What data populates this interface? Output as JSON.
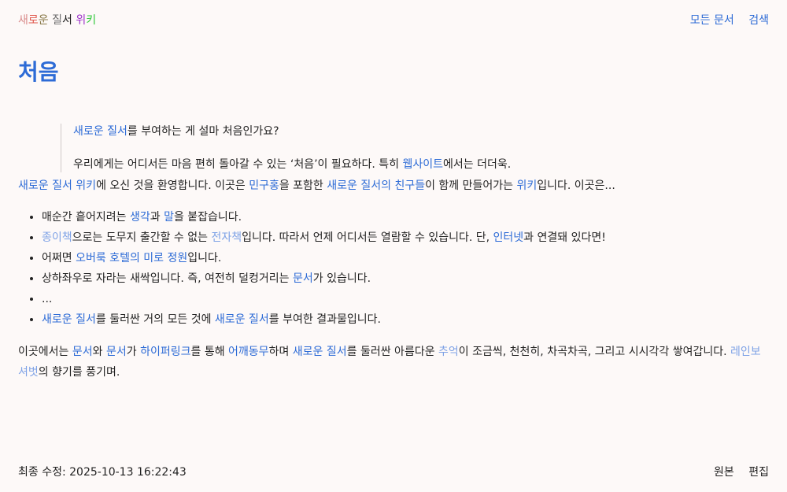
{
  "site_title": {
    "chars": [
      {
        "text": "새",
        "color": "#d98a8a"
      },
      {
        "text": "로",
        "color": "#e0574d"
      },
      {
        "text": "운",
        "color": "#8a7a4a"
      },
      {
        "text": " ",
        "color": "#222222"
      },
      {
        "text": "질",
        "color": "#6b6b6b"
      },
      {
        "text": "서",
        "color": "#222222"
      },
      {
        "text": " ",
        "color": "#222222"
      },
      {
        "text": "위",
        "color": "#9b2fc9"
      },
      {
        "text": "키",
        "color": "#2fc93a"
      }
    ]
  },
  "nav": {
    "all_docs": "모든 문서",
    "search": "검색"
  },
  "page_title": "처음",
  "quote": {
    "line1": [
      {
        "text": "새로운 질서",
        "link": true
      },
      {
        "text": "를 부여하는 게 설마 처음인가요?",
        "link": false
      }
    ],
    "line2": [
      {
        "text": "우리에게는 어디서든 마음 편히 돌아갈 수 있는 ‘처음’이 필요하다. 특히 ",
        "link": false
      },
      {
        "text": "웹사이트",
        "link": true
      },
      {
        "text": "에서는 더더욱.",
        "link": false
      }
    ]
  },
  "intro": [
    {
      "text": "새로운 질서 위키",
      "link": true
    },
    {
      "text": "에 오신 것을 환영합니다. 이곳은 ",
      "link": false
    },
    {
      "text": "민구홍",
      "link": true
    },
    {
      "text": "을 포함한 ",
      "link": false
    },
    {
      "text": "새로운 질서의 친구들",
      "link": true
    },
    {
      "text": "이 함께 만들어가는 ",
      "link": false
    },
    {
      "text": "위키",
      "link": true
    },
    {
      "text": "입니다. 이곳은...",
      "link": false
    }
  ],
  "list_items": [
    [
      {
        "text": "매순간 흩어지려는 ",
        "link": false
      },
      {
        "text": "생각",
        "link": true
      },
      {
        "text": "과 ",
        "link": false
      },
      {
        "text": "말",
        "link": true
      },
      {
        "text": "을 붙잡습니다.",
        "link": false
      }
    ],
    [
      {
        "text": "종이책",
        "link": "light"
      },
      {
        "text": "으로는 도무지 출간할 수 없는 ",
        "link": false
      },
      {
        "text": "전자책",
        "link": "light"
      },
      {
        "text": "입니다. 따라서 언제 어디서든 열람할 수 있습니다. 단, ",
        "link": false
      },
      {
        "text": "인터넷",
        "link": true
      },
      {
        "text": "과 연결돼 있다면!",
        "link": false
      }
    ],
    [
      {
        "text": "어쩌면 ",
        "link": false
      },
      {
        "text": "오버룩 호텔의 미로 정원",
        "link": true
      },
      {
        "text": "입니다.",
        "link": false
      }
    ],
    [
      {
        "text": "상하좌우로 자라는 새싹입니다. 즉, 여전히 덜컹거리는 ",
        "link": false
      },
      {
        "text": "문서",
        "link": true
      },
      {
        "text": "가 있습니다.",
        "link": false
      }
    ],
    [
      {
        "text": "...",
        "link": false
      }
    ],
    [
      {
        "text": "새로운 질서",
        "link": true
      },
      {
        "text": "를 둘러싼 거의 모든 것에 ",
        "link": false
      },
      {
        "text": "새로운 질서",
        "link": true
      },
      {
        "text": "를 부여한 결과물입니다.",
        "link": false
      }
    ]
  ],
  "closing": [
    {
      "text": "이곳에서는 ",
      "link": false
    },
    {
      "text": "문서",
      "link": true
    },
    {
      "text": "와 ",
      "link": false
    },
    {
      "text": "문서",
      "link": true
    },
    {
      "text": "가 ",
      "link": false
    },
    {
      "text": "하이퍼링크",
      "link": true
    },
    {
      "text": "를 통해 ",
      "link": false
    },
    {
      "text": "어깨동무",
      "link": true
    },
    {
      "text": "하며 ",
      "link": false
    },
    {
      "text": "새로운 질서",
      "link": true
    },
    {
      "text": "를 둘러싼 아름다운 ",
      "link": false
    },
    {
      "text": "추억",
      "link": "light"
    },
    {
      "text": "이 조금씩, 천천히, 차곡차곡, 그리고 시시각각 쌓여갑니다. ",
      "link": false
    },
    {
      "text": "레인보 셔벗",
      "link": "light"
    },
    {
      "text": "의 향기를 풍기며.",
      "link": false
    }
  ],
  "footer": {
    "last_modified": "최종 수정: 2025-10-13 16:22:43",
    "source": "원본",
    "edit": "편집"
  },
  "colors": {
    "link": "#2d6bd6",
    "link_light": "#7ea2e6",
    "background": "#fdf9f8",
    "text": "#222222"
  }
}
